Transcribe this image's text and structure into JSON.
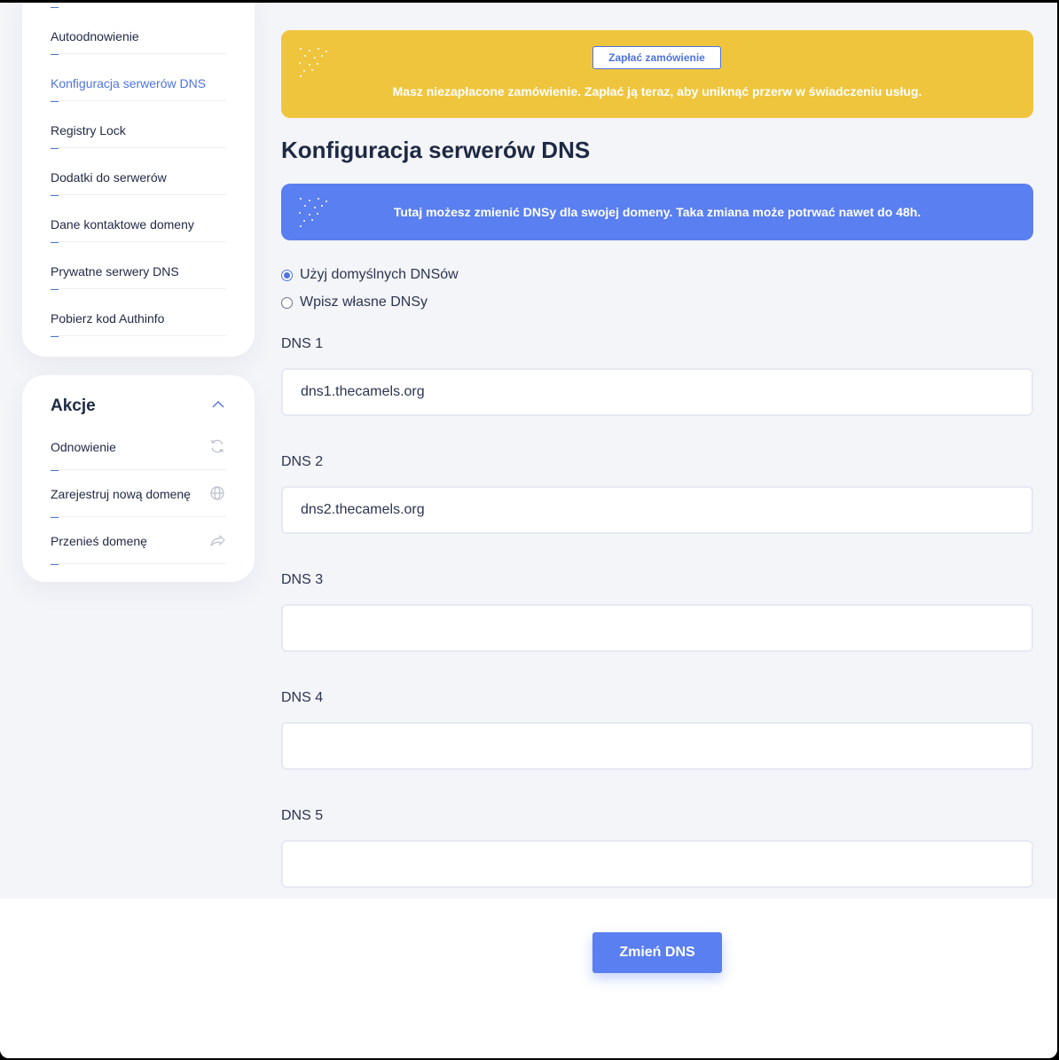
{
  "sidebar": {
    "items": [
      {
        "label": "Autoodnowienie",
        "active": false
      },
      {
        "label": "Konfiguracja serwerów DNS",
        "active": true
      },
      {
        "label": "Registry Lock",
        "active": false
      },
      {
        "label": "Dodatki do serwerów",
        "active": false
      },
      {
        "label": "Dane kontaktowe domeny",
        "active": false
      },
      {
        "label": "Prywatne serwery DNS",
        "active": false
      },
      {
        "label": "Pobierz kod Authinfo",
        "active": false
      }
    ]
  },
  "actions": {
    "title": "Akcje",
    "items": [
      {
        "label": "Odnowienie",
        "icon": "refresh-icon"
      },
      {
        "label": "Zarejestruj nową domenę",
        "icon": "globe-icon"
      },
      {
        "label": "Przenieś domenę",
        "icon": "share-arrow-icon"
      }
    ]
  },
  "payment_banner": {
    "button_label": "Zapłać zamówienie",
    "message": "Masz niezapłacone zamówienie. Zapłać ją teraz, aby uniknąć przerw w świadczeniu usług.",
    "color": "#efc53d"
  },
  "page": {
    "title": "Konfiguracja serwerów DNS"
  },
  "info_banner": {
    "message": "Tutaj możesz zmienić DNSy dla swojej domeny. Taka zmiana może potrwać nawet do 48h.",
    "color": "#5a7ff0"
  },
  "dns_mode": {
    "options": [
      {
        "label": "Użyj domyślnych DNSów",
        "checked": true
      },
      {
        "label": "Wpisz własne DNSy",
        "checked": false
      }
    ]
  },
  "dns_fields": [
    {
      "label": "DNS 1",
      "value": "dns1.thecamels.org"
    },
    {
      "label": "DNS 2",
      "value": "dns2.thecamels.org"
    },
    {
      "label": "DNS 3",
      "value": ""
    },
    {
      "label": "DNS 4",
      "value": ""
    },
    {
      "label": "DNS 5",
      "value": ""
    }
  ],
  "submit": {
    "label": "Zmień DNS"
  },
  "colors": {
    "accent": "#4e73df",
    "text": "#1e2a44"
  }
}
